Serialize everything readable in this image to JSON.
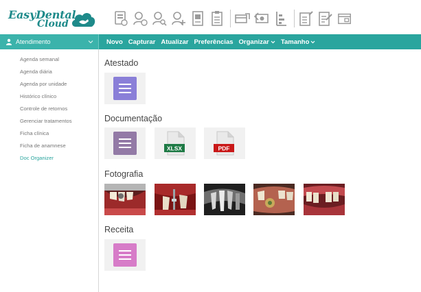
{
  "app": {
    "logo_line1": "EasyDental",
    "logo_line2": "Cloud",
    "brand_color": "#1e8a8a",
    "accent_color": "#2aa59e"
  },
  "toolbar": {
    "icons": [
      "agenda-icon",
      "patient-icon",
      "patient-search-icon",
      "add-patient-icon",
      "record-icon",
      "clipboard-icon",
      "payment-icon",
      "money-icon",
      "chart-icon",
      "document-edit-icon",
      "form-icon",
      "window-icon"
    ]
  },
  "nav": {
    "sidebar_header": "Atendimento",
    "menu": {
      "novo": "Novo",
      "capturar": "Capturar",
      "atualizar": "Atualizar",
      "preferencias": "Preferências",
      "organizar": "Organizar",
      "tamanho": "Tamanho"
    }
  },
  "sidebar": {
    "items": [
      "Agenda semanal",
      "Agenda diária",
      "Agenda por unidade",
      "Histórico clínico",
      "Controle de retornos",
      "Gerenciar tratamentos",
      "Ficha clínica",
      "Ficha de anamnese",
      "Doc Organizer"
    ],
    "active_index": 8
  },
  "sections": {
    "atestado": {
      "title": "Atestado",
      "items": [
        {
          "type": "generic-doc",
          "color": "#8a7fd8"
        }
      ]
    },
    "documentacao": {
      "title": "Documentação",
      "items": [
        {
          "type": "generic-doc",
          "color": "#937aa6"
        },
        {
          "type": "xlsx",
          "label": "XLSX",
          "color": "#1e7a45"
        },
        {
          "type": "pdf",
          "label": "PDF",
          "color": "#c91818"
        }
      ]
    },
    "fotografia": {
      "title": "Fotografia",
      "items": [
        "dental-photo-1",
        "dental-photo-2",
        "dental-xray",
        "dental-photo-4",
        "dental-photo-5"
      ]
    },
    "receita": {
      "title": "Receita",
      "items": [
        {
          "type": "generic-doc",
          "color": "#d77cc8"
        }
      ]
    }
  }
}
